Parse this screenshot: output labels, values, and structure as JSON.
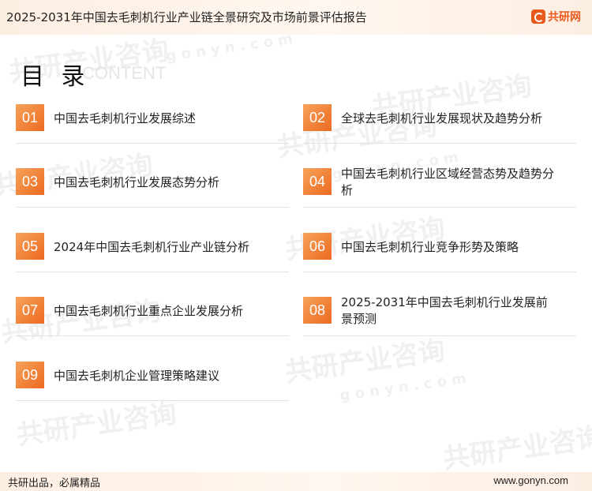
{
  "header": {
    "title": "2025-2031年中国去毛刺机行业产业链全景研究及市场前景评估报告",
    "brand_name": "共研网"
  },
  "toc": {
    "title": "目 录",
    "subtitle": "CONTENT"
  },
  "items": [
    {
      "number": "01",
      "label": "中国去毛刺机行业发展综述"
    },
    {
      "number": "02",
      "label": "全球去毛刺机行业发展现状及趋势分析"
    },
    {
      "number": "03",
      "label": "中国去毛刺机行业发展态势分析"
    },
    {
      "number": "04",
      "label": "中国去毛刺机行业区域经营态势及趋势分析"
    },
    {
      "number": "05",
      "label": "2024年中国去毛刺机行业产业链分析"
    },
    {
      "number": "06",
      "label": "中国去毛刺机行业竞争形势及策略"
    },
    {
      "number": "07",
      "label": "中国去毛刺机行业重点企业发展分析"
    },
    {
      "number": "08",
      "label": "2025-2031年中国去毛刺机行业发展前景预测"
    },
    {
      "number": "09",
      "label": "中国去毛刺机企业管理策略建议"
    }
  ],
  "footer": {
    "left_text": "共研出品，必属精品",
    "right_text": "www.gonyn.com"
  },
  "watermark": {
    "cn": "共研产业咨询",
    "en": "g o n y n . c o m"
  },
  "colors": {
    "accent": "#ec6a20",
    "accent_light": "#f7a25a",
    "band": "#fdeee2"
  }
}
